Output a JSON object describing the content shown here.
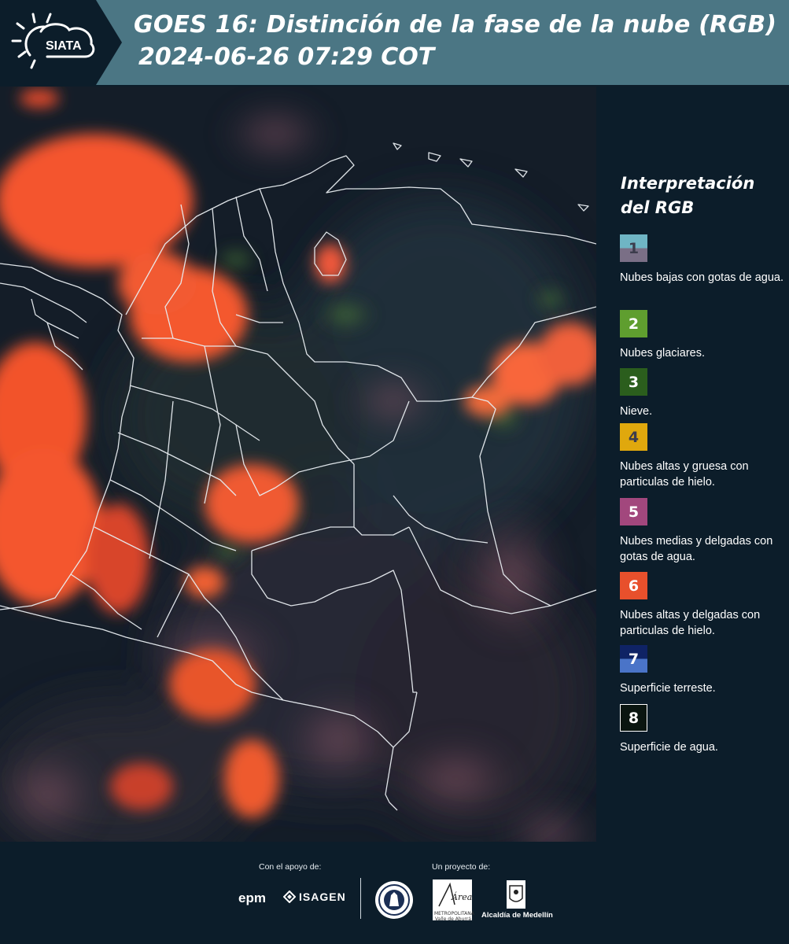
{
  "header": {
    "logo_text": "SIATA",
    "title_line1": "GOES 16: Distinción de la fase de la nube (RGB)",
    "title_line2": "2024-06-26 07:29 COT"
  },
  "legend": {
    "title": "Interpretación del RGB",
    "items": [
      {
        "num": "1",
        "label": "Nubes bajas con gotas de agua.",
        "color_top": "#6fb5c4",
        "color_bottom": "#7a6f86",
        "num_color": "#3c3c4c"
      },
      {
        "num": "2",
        "label": "Nubes glaciares.",
        "color_top": "#5f9e2f",
        "color_bottom": "#5f9e2f",
        "num_color": "#ffffff"
      },
      {
        "num": "3",
        "label": "Nieve.",
        "color_top": "#2b5e1d",
        "color_bottom": "#2b5e1d",
        "num_color": "#ffffff"
      },
      {
        "num": "4",
        "label": "Nubes altas y gruesa con particulas de hielo.",
        "color_top": "#e0a80d",
        "color_bottom": "#e0a80d",
        "num_color": "#3c3c4c"
      },
      {
        "num": "5",
        "label": "Nubes medias y delgadas con gotas de agua.",
        "color_top": "#a2477d",
        "color_bottom": "#a2477d",
        "num_color": "#ffffff"
      },
      {
        "num": "6",
        "label": "Nubes altas y delgadas con particulas de hielo.",
        "color_top": "#e8502c",
        "color_bottom": "#e8502c",
        "num_color": "#ffffff"
      },
      {
        "num": "7",
        "label": "Superficie terreste.",
        "color_top": "#0f2365",
        "color_bottom": "#4a74c8",
        "num_color": "#ffffff"
      },
      {
        "num": "8",
        "label": "Superficie de agua.",
        "color_top": "#0a1510",
        "color_bottom": "#0a1510",
        "num_color": "#ffffff"
      }
    ]
  },
  "footer": {
    "support_label": "Con el apoyo de:",
    "project_label": "Un proyecto de:",
    "epm": "epm",
    "isagen": "ISAGEN",
    "area_text": "Área",
    "area_caption": "METROPOLITANA Valle de Aburrá",
    "medellin": "Alcaldía de Medellín"
  }
}
